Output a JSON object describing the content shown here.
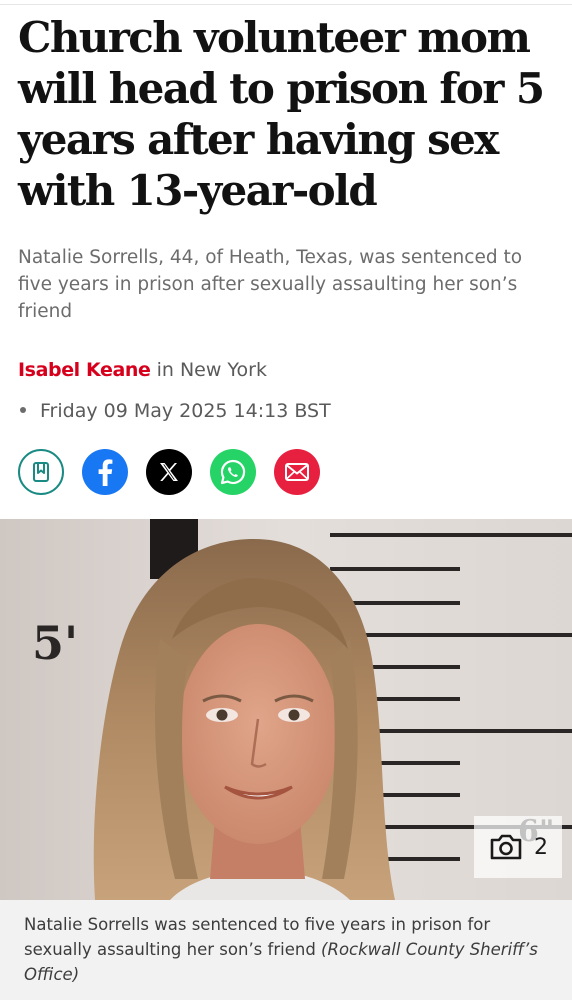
{
  "article": {
    "headline": "Church volunteer mom will head to prison for 5 years after having sex with 13-year-old",
    "standfirst": "Natalie Sorrells, 44, of Heath, Texas, was sentenced to five years in prison after sexually assaulting her son’s friend",
    "author": "Isabel Keane",
    "location": "in New York",
    "date": "Friday 09 May 2025 14:13 BST"
  },
  "share": {
    "icons": [
      "bookmark-icon",
      "facebook-icon",
      "x-icon",
      "whatsapp-icon",
      "email-icon"
    ],
    "colors": {
      "bookmark": "#1a8a83",
      "facebook": "#1877f2",
      "x": "#000000",
      "whatsapp": "#25d366",
      "email": "#e8203f"
    }
  },
  "image": {
    "height_mark_5ft": "5'",
    "height_mark_6ft": "6\"",
    "gallery_count": "2",
    "caption": "Natalie Sorrells was sentenced to five years in prison for sexually assaulting her son’s friend",
    "credit": "(Rockwall County Sheriff’s Office)"
  },
  "theme": {
    "author_color": "#d6001c"
  }
}
